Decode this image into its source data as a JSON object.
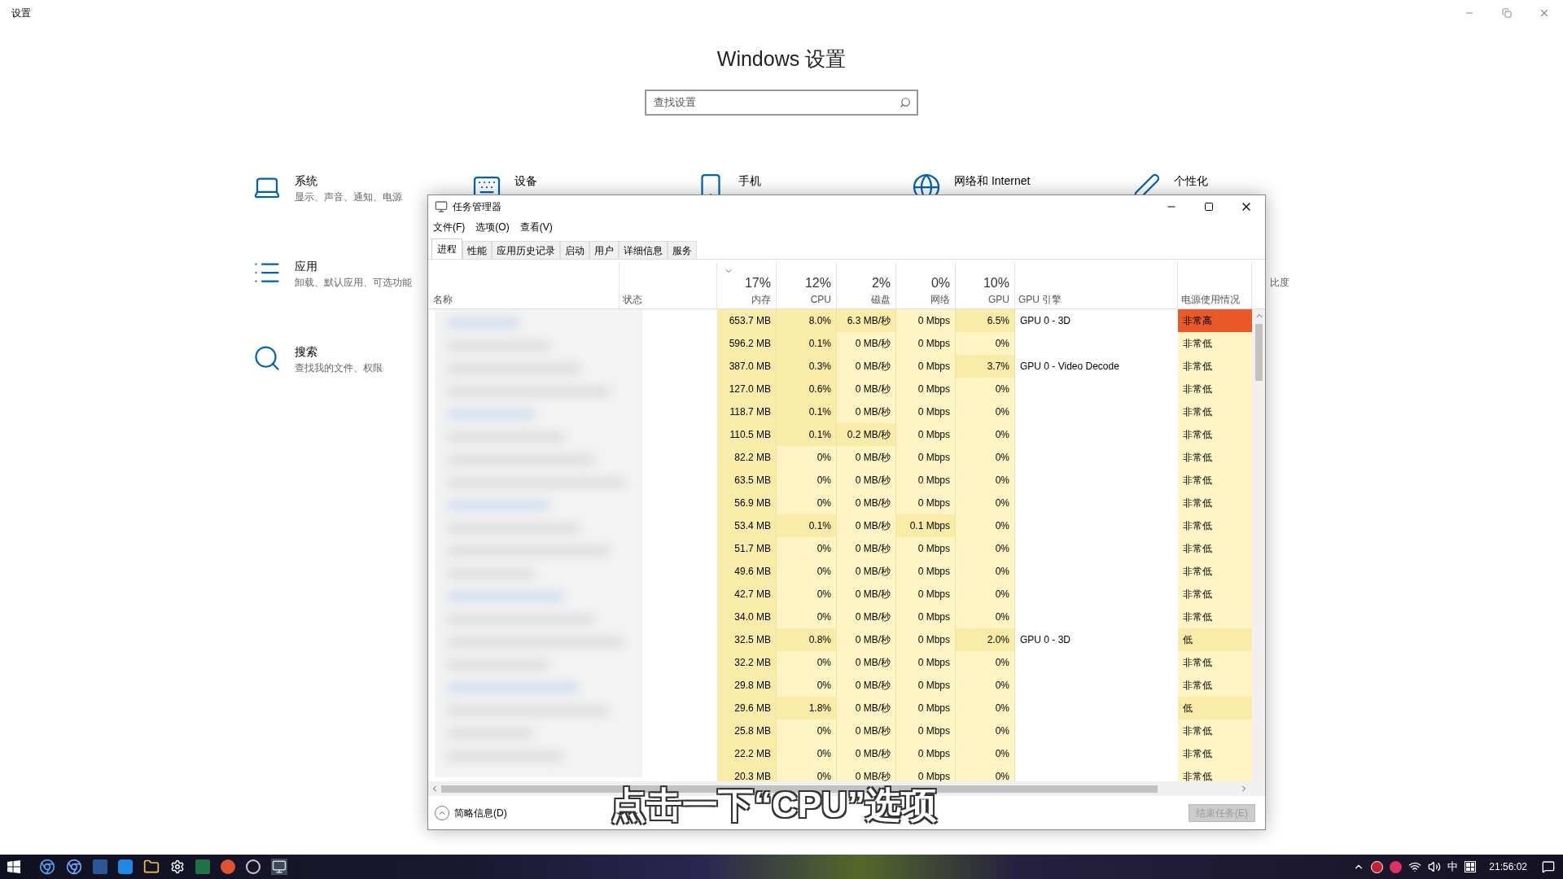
{
  "settings": {
    "title": "设置",
    "heading": "Windows 设置",
    "search": {
      "placeholder": "查找设置"
    },
    "categories": [
      {
        "kind": "system",
        "title": "系统",
        "subtitle": "显示、声音、通知、电源"
      },
      {
        "kind": "devices",
        "title": "设备"
      },
      {
        "kind": "phone",
        "title": "手机"
      },
      {
        "kind": "network",
        "title": "网络和 Internet"
      },
      {
        "kind": "personalize",
        "title": "个性化"
      },
      {
        "kind": "apps",
        "title": "应用",
        "subtitle": "卸载、默认应用、可选功能"
      },
      {
        "kind": "search",
        "title": "搜索",
        "subtitle": "查找我的文件、权限"
      }
    ],
    "partial_text": "比度"
  },
  "task_manager": {
    "title": "任务管理器",
    "menu": [
      "文件(F)",
      "选项(O)",
      "查看(V)"
    ],
    "tabs": [
      {
        "label": "进程",
        "selected": true
      },
      {
        "label": "性能",
        "selected": false
      },
      {
        "label": "应用历史记录",
        "selected": false
      },
      {
        "label": "启动",
        "selected": false
      },
      {
        "label": "用户",
        "selected": false
      },
      {
        "label": "详细信息",
        "selected": false
      },
      {
        "label": "服务",
        "selected": false
      }
    ],
    "columns": [
      {
        "label": "名称"
      },
      {
        "label": "状态"
      },
      {
        "percent": "17%",
        "label": "内存",
        "sorted": true
      },
      {
        "percent": "12%",
        "label": "CPU",
        "sorted": false
      },
      {
        "percent": "2%",
        "label": "磁盘",
        "sorted": false
      },
      {
        "percent": "0%",
        "label": "网络",
        "sorted": false
      },
      {
        "percent": "10%",
        "label": "GPU",
        "sorted": false
      },
      {
        "label": "GPU 引擎"
      },
      {
        "label": "电源使用情况"
      }
    ],
    "rows": [
      {
        "cells": [
          "",
          "",
          "653.7 MB",
          "8.0%",
          "6.3 MB/秒",
          "0 Mbps",
          "6.5%",
          "GPU 0 - 3D",
          "非常高"
        ],
        "hot": [
          true,
          true,
          true,
          false,
          true
        ],
        "power_alert": true,
        "power_shaded": false
      },
      {
        "cells": [
          "",
          "",
          "596.2 MB",
          "0.1%",
          "0 MB/秒",
          "0 Mbps",
          "0%",
          "",
          "非常低"
        ],
        "hot": [
          true,
          true,
          false,
          false,
          false
        ],
        "power_alert": false,
        "power_shaded": false
      },
      {
        "cells": [
          "",
          "",
          "387.0 MB",
          "0.3%",
          "0 MB/秒",
          "0 Mbps",
          "3.7%",
          "GPU 0 - Video Decode",
          "非常低"
        ],
        "hot": [
          true,
          true,
          false,
          false,
          true
        ],
        "power_alert": false,
        "power_shaded": false
      },
      {
        "cells": [
          "",
          "",
          "127.0 MB",
          "0.6%",
          "0 MB/秒",
          "0 Mbps",
          "0%",
          "",
          "非常低"
        ],
        "hot": [
          true,
          true,
          false,
          false,
          false
        ],
        "power_alert": false,
        "power_shaded": false
      },
      {
        "cells": [
          "",
          "",
          "118.7 MB",
          "0.1%",
          "0 MB/秒",
          "0 Mbps",
          "0%",
          "",
          "非常低"
        ],
        "hot": [
          true,
          true,
          false,
          false,
          false
        ],
        "power_alert": false,
        "power_shaded": false
      },
      {
        "cells": [
          "",
          "",
          "110.5 MB",
          "0.1%",
          "0.2 MB/秒",
          "0 Mbps",
          "0%",
          "",
          "非常低"
        ],
        "hot": [
          true,
          true,
          true,
          false,
          false
        ],
        "power_alert": false,
        "power_shaded": false
      },
      {
        "cells": [
          "",
          "",
          "82.2 MB",
          "0%",
          "0 MB/秒",
          "0 Mbps",
          "0%",
          "",
          "非常低"
        ],
        "hot": [
          true,
          false,
          false,
          false,
          false
        ],
        "power_alert": false,
        "power_shaded": false
      },
      {
        "cells": [
          "",
          "",
          "63.5 MB",
          "0%",
          "0 MB/秒",
          "0 Mbps",
          "0%",
          "",
          "非常低"
        ],
        "hot": [
          true,
          false,
          false,
          false,
          false
        ],
        "power_alert": false,
        "power_shaded": false
      },
      {
        "cells": [
          "",
          "",
          "56.9 MB",
          "0%",
          "0 MB/秒",
          "0 Mbps",
          "0%",
          "",
          "非常低"
        ],
        "hot": [
          true,
          false,
          false,
          false,
          false
        ],
        "power_alert": false,
        "power_shaded": false
      },
      {
        "cells": [
          "",
          "",
          "53.4 MB",
          "0.1%",
          "0 MB/秒",
          "0.1 Mbps",
          "0%",
          "",
          "非常低"
        ],
        "hot": [
          true,
          true,
          false,
          true,
          false
        ],
        "power_alert": false,
        "power_shaded": false
      },
      {
        "cells": [
          "",
          "",
          "51.7 MB",
          "0%",
          "0 MB/秒",
          "0 Mbps",
          "0%",
          "",
          "非常低"
        ],
        "hot": [
          true,
          false,
          false,
          false,
          false
        ],
        "power_alert": false,
        "power_shaded": false
      },
      {
        "cells": [
          "",
          "",
          "49.6 MB",
          "0%",
          "0 MB/秒",
          "0 Mbps",
          "0%",
          "",
          "非常低"
        ],
        "hot": [
          true,
          false,
          false,
          false,
          false
        ],
        "power_alert": false,
        "power_shaded": false
      },
      {
        "cells": [
          "",
          "",
          "42.7 MB",
          "0%",
          "0 MB/秒",
          "0 Mbps",
          "0%",
          "",
          "非常低"
        ],
        "hot": [
          true,
          false,
          false,
          false,
          false
        ],
        "power_alert": false,
        "power_shaded": false
      },
      {
        "cells": [
          "",
          "",
          "34.0 MB",
          "0%",
          "0 MB/秒",
          "0 Mbps",
          "0%",
          "",
          "非常低"
        ],
        "hot": [
          true,
          false,
          false,
          false,
          false
        ],
        "power_alert": false,
        "power_shaded": false
      },
      {
        "cells": [
          "",
          "",
          "32.5 MB",
          "0.8%",
          "0 MB/秒",
          "0 Mbps",
          "2.0%",
          "GPU 0 - 3D",
          "低"
        ],
        "hot": [
          true,
          true,
          false,
          false,
          true
        ],
        "power_alert": false,
        "power_shaded": true
      },
      {
        "cells": [
          "",
          "",
          "32.2 MB",
          "0%",
          "0 MB/秒",
          "0 Mbps",
          "0%",
          "",
          "非常低"
        ],
        "hot": [
          true,
          false,
          false,
          false,
          false
        ],
        "power_alert": false,
        "power_shaded": false
      },
      {
        "cells": [
          "",
          "",
          "29.8 MB",
          "0%",
          "0 MB/秒",
          "0 Mbps",
          "0%",
          "",
          "非常低"
        ],
        "hot": [
          true,
          false,
          false,
          false,
          false
        ],
        "power_alert": false,
        "power_shaded": false
      },
      {
        "cells": [
          "",
          "",
          "29.6 MB",
          "1.8%",
          "0 MB/秒",
          "0 Mbps",
          "0%",
          "",
          "低"
        ],
        "hot": [
          true,
          true,
          false,
          false,
          false
        ],
        "power_alert": false,
        "power_shaded": true
      },
      {
        "cells": [
          "",
          "",
          "25.8 MB",
          "0%",
          "0 MB/秒",
          "0 Mbps",
          "0%",
          "",
          "非常低"
        ],
        "hot": [
          true,
          false,
          false,
          false,
          false
        ],
        "power_alert": false,
        "power_shaded": false
      },
      {
        "cells": [
          "",
          "",
          "22.2 MB",
          "0%",
          "0 MB/秒",
          "0 Mbps",
          "0%",
          "",
          "非常低"
        ],
        "hot": [
          true,
          false,
          false,
          false,
          false
        ],
        "power_alert": false,
        "power_shaded": false
      },
      {
        "cells": [
          "",
          "",
          "20.3 MB",
          "0%",
          "0 MB/秒",
          "0 Mbps",
          "0%",
          "",
          "非常低"
        ],
        "hot": [
          true,
          false,
          false,
          false,
          false
        ],
        "power_alert": false,
        "power_shaded": false
      }
    ],
    "footer": {
      "details": "简略信息(D)",
      "end_task": {
        "label": "结束任务(E)",
        "disabled": true
      }
    }
  },
  "caption": "点击一下“CPU”选项",
  "taskbar": {
    "ime": "中",
    "time": "21:56:02"
  }
}
